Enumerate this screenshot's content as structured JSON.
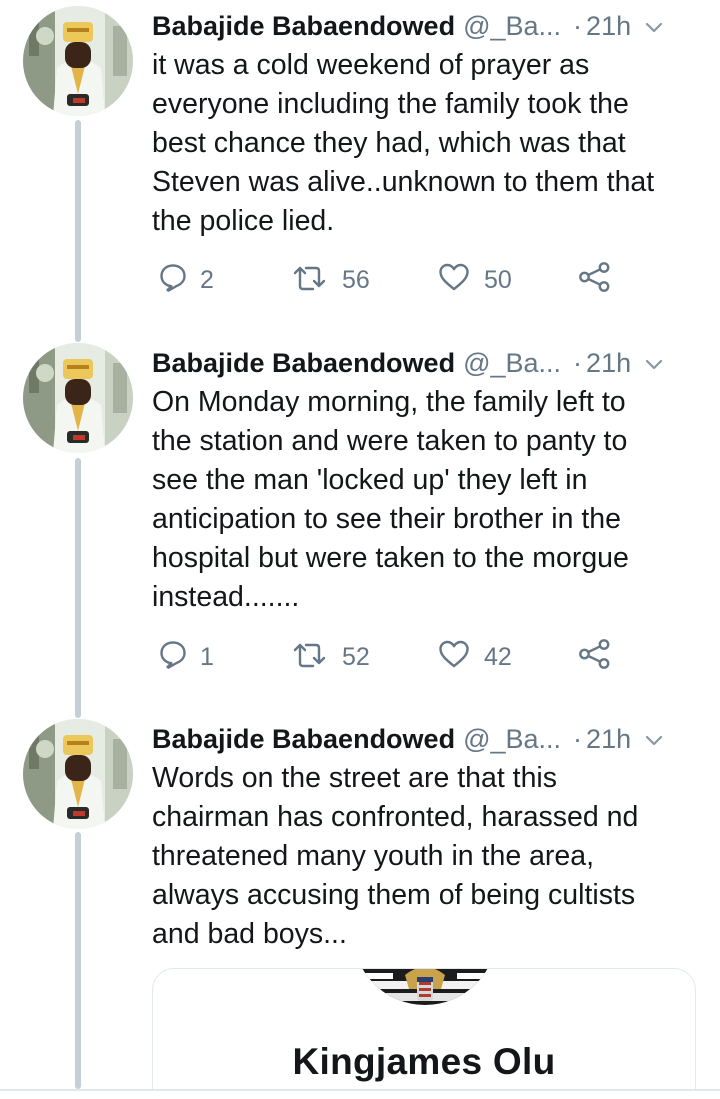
{
  "tweets": [
    {
      "author_name": "Babajide Babaendowed",
      "handle": "@_Ba...",
      "separator": "·",
      "time": "21h",
      "text": "it was a cold weekend of prayer as\neveryone including the family took the\nbest chance they had, which was that\nSteven was alive..unknown to them that\nthe police lied.",
      "replies": "2",
      "retweets": "56",
      "likes": "50"
    },
    {
      "author_name": "Babajide Babaendowed",
      "handle": "@_Ba...",
      "separator": "·",
      "time": "21h",
      "text": "On Monday morning,  the family left to\nthe station and were taken to panty to\nsee the man 'locked up' they left in\nanticipation to see their brother in the\nhospital but were taken to the morgue\ninstead.......",
      "replies": "1",
      "retweets": "52",
      "likes": "42"
    },
    {
      "author_name": "Babajide Babaendowed",
      "handle": "@_Ba...",
      "separator": "·",
      "time": "21h",
      "text": "Words on the street are that this\nchairman has confronted, harassed nd\nthreatened many youth in the area,\nalways accusing them of being cultists\nand bad boys..."
    }
  ],
  "quoted_card": {
    "name": "Kingjames Olu"
  },
  "icons": {
    "reply": "reply-icon",
    "retweet": "retweet-icon",
    "like": "like-icon",
    "share": "share-icon",
    "menu": "chevron-down-icon"
  },
  "colors": {
    "text_primary": "#14171a",
    "text_secondary": "#657786",
    "thread_line": "#c4cfd6",
    "card_border": "#e1e8ed"
  }
}
